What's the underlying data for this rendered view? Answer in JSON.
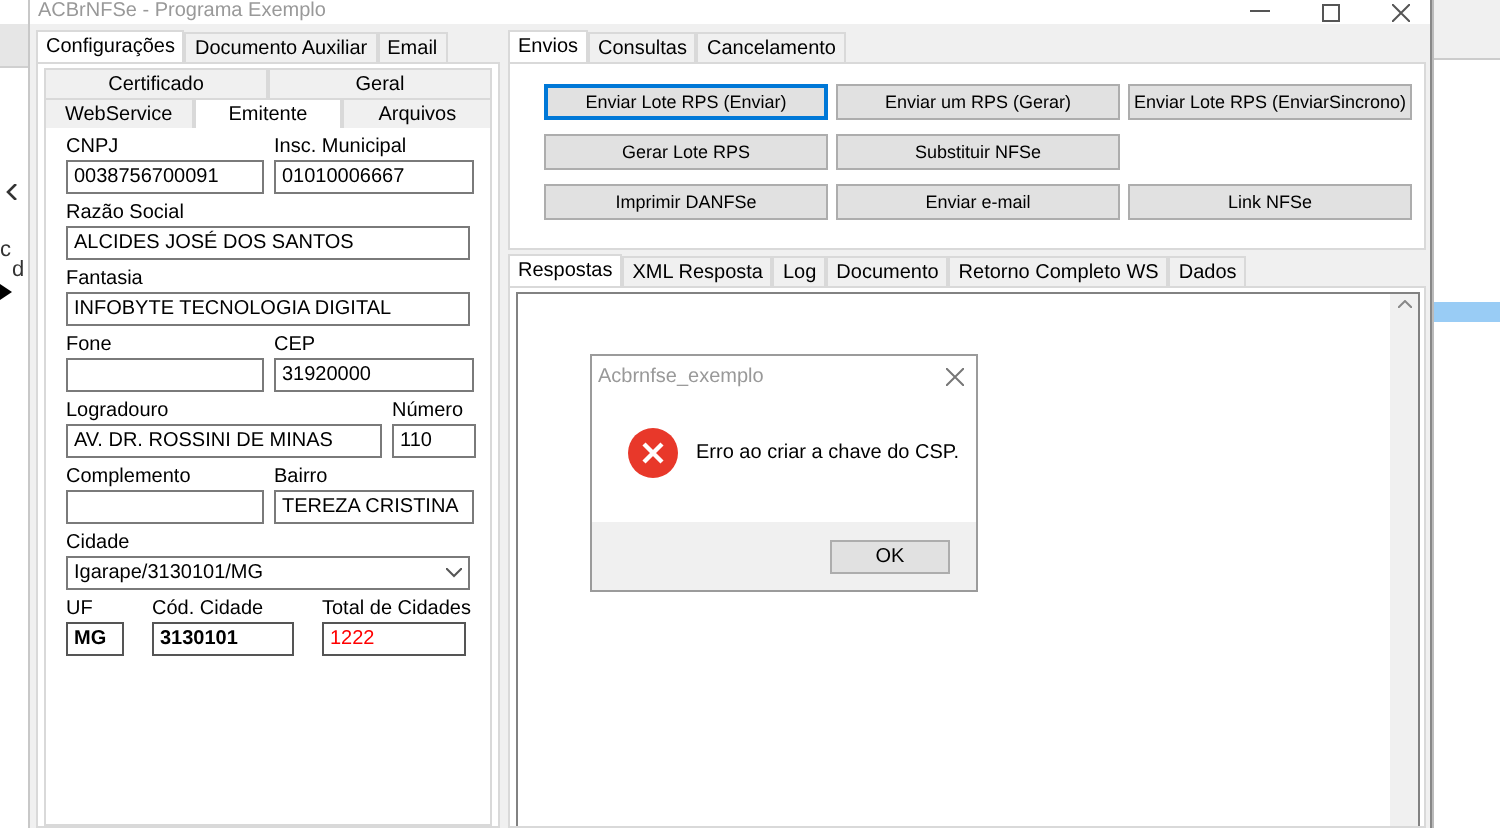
{
  "window": {
    "title": "ACBrNFSe - Programa Exemplo"
  },
  "background_fragments": [
    "c",
    "d"
  ],
  "main_tabs": [
    {
      "label": "Configurações",
      "selected": true
    },
    {
      "label": "Documento Auxiliar",
      "selected": false
    },
    {
      "label": "Email",
      "selected": false
    }
  ],
  "config_subtabs": [
    [
      {
        "label": "Certificado",
        "selected": false
      },
      {
        "label": "Geral",
        "selected": false
      }
    ],
    [
      {
        "label": "WebService",
        "selected": false
      },
      {
        "label": "Emitente",
        "selected": true
      },
      {
        "label": "Arquivos",
        "selected": false
      }
    ]
  ],
  "emitente_rows": [
    [
      {
        "label": "CNPJ",
        "value": "0038756700091",
        "kind": "text"
      },
      {
        "label": "Insc. Municipal",
        "value": "01010006667",
        "kind": "text"
      }
    ],
    [
      {
        "label": "Razão Social",
        "value": "ALCIDES JOSÉ DOS SANTOS",
        "kind": "text"
      }
    ],
    [
      {
        "label": "Fantasia",
        "value": "INFOBYTE TECNOLOGIA DIGITAL",
        "kind": "text"
      }
    ],
    [
      {
        "label": "Fone",
        "kind": "text"
      },
      {
        "label": "CEP",
        "value": "31920000",
        "kind": "text"
      }
    ],
    [
      {
        "label": "Logradouro",
        "value": "AV. DR. ROSSINI DE MINAS",
        "kind": "text"
      },
      {
        "label": "Número",
        "value": "110",
        "kind": "text"
      }
    ],
    [
      {
        "label": "Complemento",
        "kind": "text"
      },
      {
        "label": "Bairro",
        "value": "TEREZA CRISTINA",
        "kind": "text"
      }
    ],
    [
      {
        "label": "Cidade",
        "value": "Igarape/3130101/MG",
        "kind": "select"
      }
    ],
    [
      {
        "label": "UF",
        "value": "MG",
        "kind": "bold"
      },
      {
        "label": "Cód. Cidade",
        "value": "3130101",
        "kind": "bold"
      },
      {
        "label": "Total de Cidades",
        "value": "1222",
        "kind": "alert"
      }
    ]
  ],
  "action_tabs": [
    {
      "label": "Envios",
      "selected": true
    },
    {
      "label": "Consultas",
      "selected": false
    },
    {
      "label": "Cancelamento",
      "selected": false
    }
  ],
  "action_buttons": [
    [
      {
        "label": "Enviar Lote RPS (Enviar)",
        "focused": true
      },
      {
        "label": "Enviar um RPS (Gerar)",
        "focused": false
      },
      {
        "label": "Enviar Lote RPS (EnviarSincrono)",
        "focused": false
      }
    ],
    [
      {
        "label": "Gerar Lote RPS",
        "focused": false
      },
      {
        "label": "Substituir NFSe",
        "focused": false
      }
    ],
    [
      {
        "label": "Imprimir DANFSe",
        "focused": false
      },
      {
        "label": "Enviar e-mail",
        "focused": false
      },
      {
        "label": "Link NFSe",
        "focused": false
      }
    ]
  ],
  "response_tabs": [
    {
      "label": "Respostas",
      "selected": true
    },
    {
      "label": "XML Resposta",
      "selected": false
    },
    {
      "label": "Log",
      "selected": false
    },
    {
      "label": "Documento",
      "selected": false
    },
    {
      "label": "Retorno Completo WS",
      "selected": false
    },
    {
      "label": "Dados",
      "selected": false
    }
  ],
  "dialog": {
    "title": "Acbrnfse_exemplo",
    "message": "Erro ao criar a chave do CSP.",
    "button": "OK"
  }
}
